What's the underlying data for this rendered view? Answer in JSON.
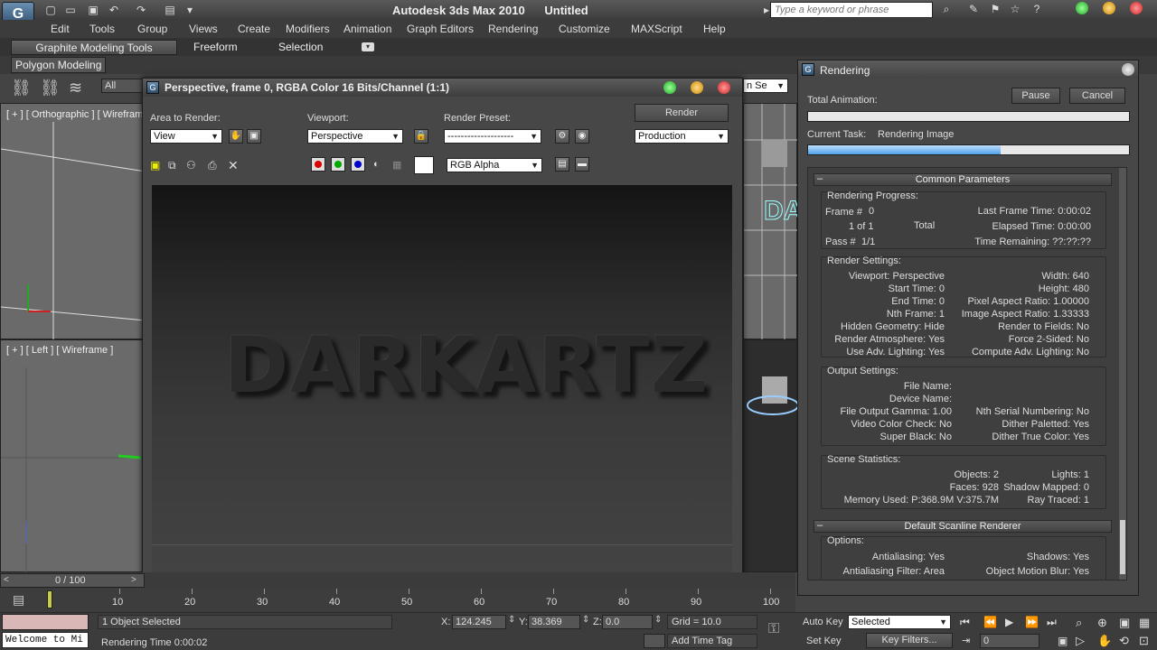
{
  "app": {
    "title": "Autodesk 3ds Max  2010",
    "doc": "Untitled",
    "logo": "G",
    "search_placeholder": "Type a keyword or phrase"
  },
  "menu": [
    "Edit",
    "Tools",
    "Group",
    "Views",
    "Create",
    "Modifiers",
    "Animation",
    "Graph Editors",
    "Rendering",
    "Customize",
    "MAXScript",
    "Help"
  ],
  "ribbon": {
    "tabs": [
      "Graphite Modeling Tools",
      "Freeform",
      "Selection"
    ],
    "sub_tab": "Polygon Modeling",
    "selection_filter": "All",
    "named_sel": "n Se"
  },
  "viewports": {
    "top_left": "[ + ] [ Orthographic ] [ Wirefram",
    "bottom_left": "[ + ] [ Left ] [ Wireframe ]"
  },
  "frame_window": {
    "title": "Perspective, frame 0, RGBA Color 16 Bits/Channel (1:1)",
    "area_label": "Area to Render:",
    "area_value": "View",
    "viewport_label": "Viewport:",
    "viewport_value": "Perspective",
    "preset_label": "Render Preset:",
    "preset_value": "--------------------",
    "render_button": "Render",
    "production_value": "Production",
    "channel_value": "RGB Alpha",
    "render_text": "DARKARTZ"
  },
  "rendering_dialog": {
    "title": "Rendering",
    "total_animation_label": "Total Animation:",
    "pause_button": "Pause",
    "cancel_button": "Cancel",
    "current_task_label": "Current Task:",
    "current_task_value": "Rendering Image",
    "progress": 0.6,
    "common_header": "Common Parameters",
    "progress_group": "Rendering Progress:",
    "frame_label": "Frame #",
    "frame_value": "0",
    "of_label": "1 of 1",
    "total_label": "Total",
    "pass_label": "Pass #",
    "pass_value": "1/1",
    "last_frame_time": "Last Frame Time: 0:00:02",
    "elapsed_time": "Elapsed Time: 0:00:00",
    "time_remaining": "Time Remaining: ??:??:??",
    "render_settings_group": "Render Settings:",
    "rs_left": [
      "Viewport: Perspective",
      "Start Time: 0",
      "End Time: 0",
      "Nth Frame: 1",
      "Hidden Geometry: Hide",
      "Render Atmosphere: Yes",
      "Use Adv. Lighting: Yes"
    ],
    "rs_right": [
      "Width: 640",
      "Height: 480",
      "Pixel Aspect Ratio: 1.00000",
      "Image Aspect Ratio: 1.33333",
      "Render to Fields: No",
      "Force 2-Sided: No",
      "Compute Adv. Lighting: No"
    ],
    "output_group": "Output Settings:",
    "out_left": [
      "File Name:",
      "Device Name:",
      "File Output Gamma: 1.00",
      "Video Color Check: No",
      "Super Black: No"
    ],
    "out_right": [
      "",
      "",
      "Nth Serial Numbering: No",
      "Dither Paletted: Yes",
      "Dither True Color: Yes"
    ],
    "scene_group": "Scene Statistics:",
    "sc_left": [
      "Objects: 2",
      "Faces: 928",
      "Memory Used: P:368.9M V:375.7M"
    ],
    "sc_right": [
      "Lights: 1",
      "Shadow Mapped: 0",
      "Ray Traced: 1"
    ],
    "scanline_header": "Default Scanline Renderer",
    "options_group": "Options:",
    "op_left": [
      "Antialiasing: Yes",
      "Antialiasing Filter: Area"
    ],
    "op_right": [
      "Shadows: Yes",
      "Object Motion Blur: Yes"
    ]
  },
  "timeline": {
    "frame_counter": "0 / 100",
    "ticks": [
      "10",
      "20",
      "30",
      "40",
      "50",
      "60",
      "70",
      "80",
      "90",
      "100"
    ]
  },
  "status": {
    "script_listener": "Welcome to Mi",
    "selected_text": "1 Object Selected",
    "render_time": "Rendering Time  0:00:02",
    "x_label": "X:",
    "x_value": "124.245",
    "y_label": "Y:",
    "y_value": "38.369",
    "z_label": "Z:",
    "z_value": "0.0",
    "grid": "Grid = 10.0",
    "add_time_tag": "Add Time Tag",
    "auto_key": "Auto Key",
    "set_key": "Set Key",
    "key_mode_value": "Selected",
    "key_filters": "Key Filters...",
    "frame_value": "0"
  }
}
